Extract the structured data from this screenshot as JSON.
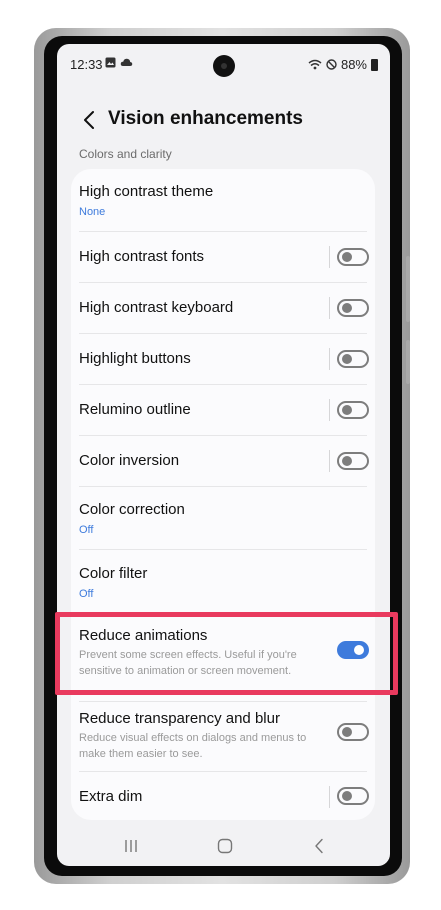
{
  "status_bar": {
    "time": "12:33",
    "battery": "88%",
    "left_icons": [
      "gallery-icon",
      "cloud-icon"
    ],
    "right_icons": [
      "wifi-icon",
      "do-not-disturb-icon",
      "battery-icon"
    ]
  },
  "header": {
    "title": "Vision enhancements",
    "back_icon": "back-chevron-icon"
  },
  "section": {
    "label": "Colors and clarity"
  },
  "items": [
    {
      "title": "High contrast theme",
      "value": "None"
    },
    {
      "title": "High contrast fonts",
      "toggle_on": false
    },
    {
      "title": "High contrast keyboard",
      "toggle_on": false
    },
    {
      "title": "Highlight buttons",
      "toggle_on": false
    },
    {
      "title": "Relumino outline",
      "toggle_on": false
    },
    {
      "title": "Color inversion",
      "toggle_on": false
    },
    {
      "title": "Color correction",
      "value": "Off"
    },
    {
      "title": "Color filter",
      "value": "Off"
    },
    {
      "title": "Reduce animations",
      "description": "Prevent some screen effects. Useful if you're sensitive to animation or screen movement.",
      "toggle_on": true,
      "highlighted": true
    },
    {
      "title": "Reduce transparency and blur",
      "description": "Reduce visual effects on dialogs and menus to make them easier to see.",
      "toggle_on": false
    },
    {
      "title": "Extra dim",
      "toggle_on": false
    }
  ],
  "navbar": {
    "buttons": [
      "recent-apps-icon",
      "home-icon",
      "back-icon"
    ]
  },
  "colors": {
    "accent": "#3e7bdc",
    "highlight_border": "#e93a5e",
    "background": "#f2f2f4",
    "card": "#fbfbfd"
  }
}
